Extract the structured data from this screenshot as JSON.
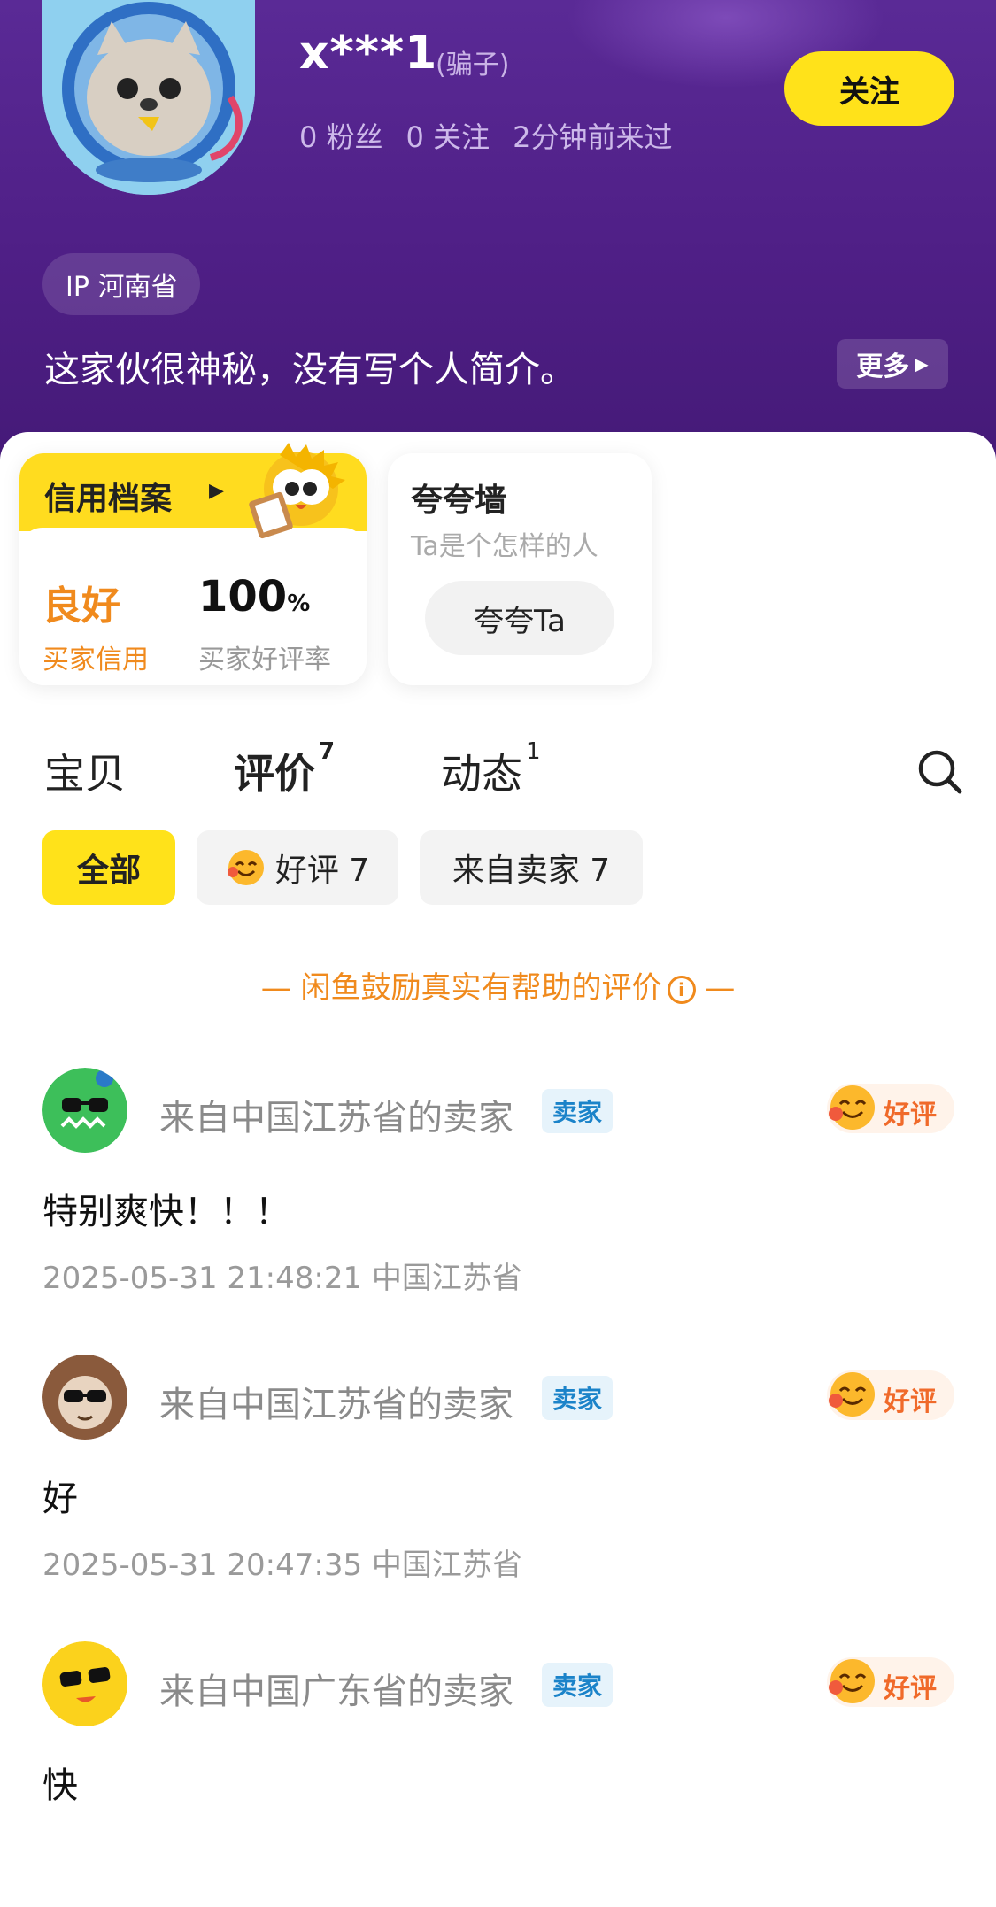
{
  "profile": {
    "username": "x***1",
    "username_note": "(骗子)",
    "fans": "0 粉丝",
    "following": "0 关注",
    "last_seen": "2分钟前来过",
    "follow_label": "关注",
    "ip": "IP 河南省",
    "bio": "这家伙很神秘，没有写个人简介。",
    "more_label": "更多"
  },
  "credit": {
    "title": "信用档案",
    "level": "良好",
    "level_label": "买家信用",
    "rate": "100",
    "rate_unit": "%",
    "rate_label": "买家好评率"
  },
  "praise": {
    "title": "夸夸墙",
    "subtitle": "Ta是个怎样的人",
    "button": "夸夸Ta"
  },
  "tabs": [
    {
      "label": "宝贝",
      "count": ""
    },
    {
      "label": "评价",
      "count": "7"
    },
    {
      "label": "动态",
      "count": "1"
    }
  ],
  "filters": [
    {
      "label": "全部"
    },
    {
      "label": "好评 7"
    },
    {
      "label": "来自卖家 7"
    }
  ],
  "notice": "— 闲鱼鼓励真实有帮助的评价",
  "notice_tail": "—",
  "reviews": [
    {
      "from": "来自中国江苏省的卖家",
      "tag": "卖家",
      "rating": "好评",
      "text": "特别爽快！！！",
      "meta": "2025-05-31 21:48:21 中国江苏省"
    },
    {
      "from": "来自中国江苏省的卖家",
      "tag": "卖家",
      "rating": "好评",
      "text": "好",
      "meta": "2025-05-31 20:47:35 中国江苏省"
    },
    {
      "from": "来自中国广东省的卖家",
      "tag": "卖家",
      "rating": "好评",
      "text": "快",
      "meta": ""
    }
  ],
  "colors": {
    "header_purple": "#4f1f86",
    "accent_yellow": "#ffe21a",
    "orange": "#f08a1d",
    "seller_tag_blue": "#1b83c9"
  }
}
